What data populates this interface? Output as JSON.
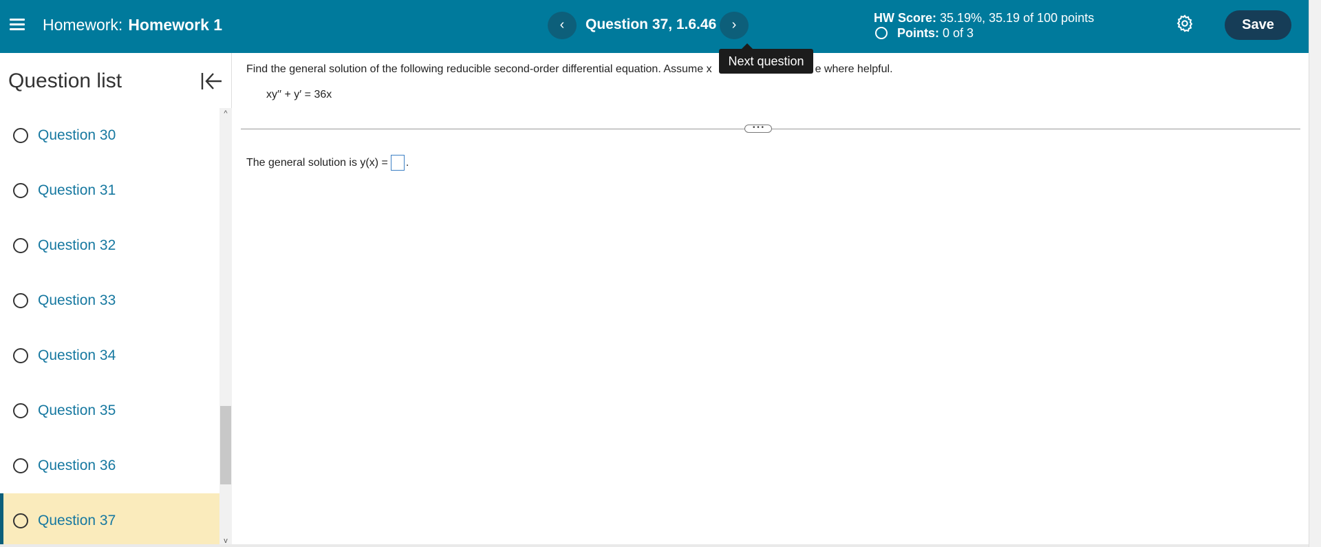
{
  "header": {
    "homework_prefix": "Homework:",
    "homework_name": "Homework 1",
    "question_title": "Question 37, 1.6.46",
    "prev_symbol": "‹",
    "next_symbol": "›",
    "hw_score_label": "HW Score:",
    "hw_score_value": "35.19%, 35.19 of 100 points",
    "points_label": "Points:",
    "points_value": "0 of 3",
    "save_label": "Save"
  },
  "tooltip": {
    "text": "Next question"
  },
  "sidebar": {
    "title": "Question list",
    "items": [
      {
        "label": "Question 30"
      },
      {
        "label": "Question 31"
      },
      {
        "label": "Question 32"
      },
      {
        "label": "Question 33"
      },
      {
        "label": "Question 34"
      },
      {
        "label": "Question 35"
      },
      {
        "label": "Question 36"
      },
      {
        "label": "Question 37"
      }
    ],
    "scroll_up": "^",
    "scroll_down": "v"
  },
  "main": {
    "instructions_start": "Find the general solution of the following reducible second-order differential equation. Assume x",
    "instructions_end": "e where helpful.",
    "equation": "xy′′ + y′ = 36x",
    "handle": "• • •",
    "answer_prefix": "The general solution is y(x) =",
    "answer_suffix": "."
  },
  "colors": {
    "header_bg": "#007a9c",
    "nav_button_bg": "#0d5f7a",
    "save_button_bg": "#163d57",
    "active_item_bg": "#faebbc",
    "link_color": "#1678a0"
  }
}
